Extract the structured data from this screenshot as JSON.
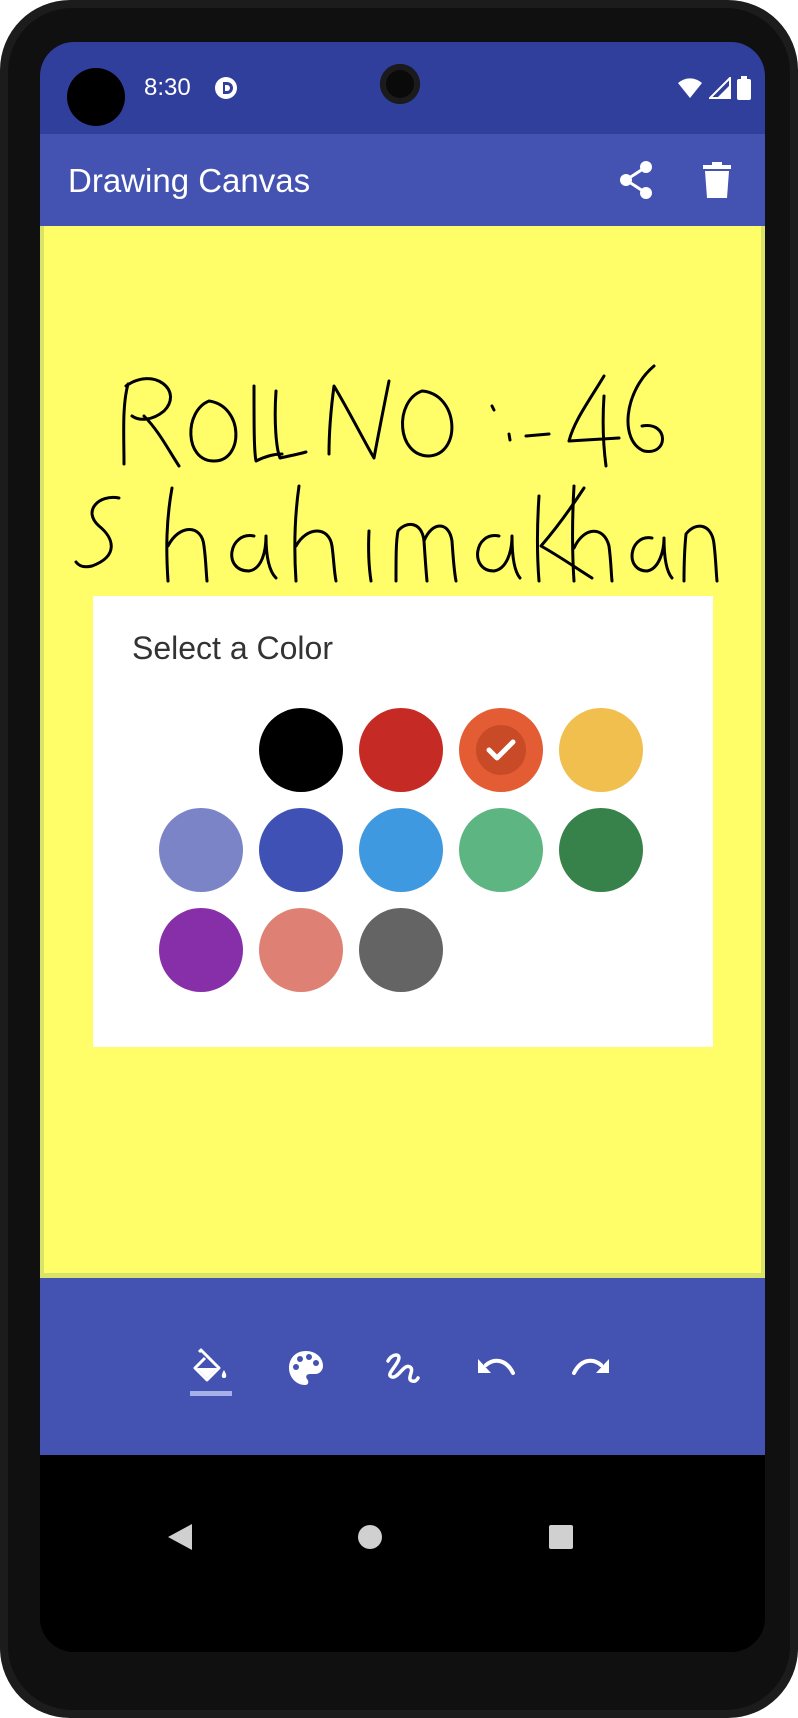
{
  "status_bar": {
    "time": "8:30"
  },
  "app_bar": {
    "title": "Drawing Canvas",
    "share_icon": "share-icon",
    "delete_icon": "trash-icon",
    "color": "#4452b1"
  },
  "canvas": {
    "background": "#fffd68",
    "handwriting_line1": "ROLLNO:-46",
    "handwriting_line2": "shahimakhan"
  },
  "color_dialog": {
    "title": "Select a Color",
    "selected": "#e45c34",
    "swatches": [
      {
        "name": "white",
        "color": "#ffffff"
      },
      {
        "name": "black",
        "color": "#000000"
      },
      {
        "name": "red",
        "color": "#c62a24"
      },
      {
        "name": "orange",
        "color": "#e45c34"
      },
      {
        "name": "amber",
        "color": "#f0bf4d"
      },
      {
        "name": "lavender",
        "color": "#7b84c6"
      },
      {
        "name": "indigo",
        "color": "#3f51b5"
      },
      {
        "name": "blue",
        "color": "#3f99e0"
      },
      {
        "name": "light-green",
        "color": "#5db582"
      },
      {
        "name": "green",
        "color": "#37814a"
      },
      {
        "name": "purple",
        "color": "#872fa8"
      },
      {
        "name": "salmon",
        "color": "#de8174"
      },
      {
        "name": "gray",
        "color": "#646464"
      }
    ]
  },
  "toolbar": {
    "tools": [
      {
        "name": "fill-icon",
        "active": true
      },
      {
        "name": "palette-icon",
        "active": false
      },
      {
        "name": "brush-icon",
        "active": false
      },
      {
        "name": "undo-icon",
        "active": false
      },
      {
        "name": "redo-icon",
        "active": false
      }
    ]
  },
  "nav_bar": {
    "back_icon": "back-icon",
    "home_icon": "home-icon",
    "recents_icon": "recents-icon"
  }
}
